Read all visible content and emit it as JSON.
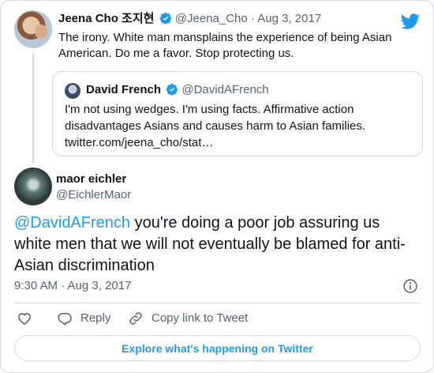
{
  "parent_tweet": {
    "name": "Jeena Cho 조지현",
    "handle": "@Jeena_Cho",
    "separator": "·",
    "date": "Aug 3, 2017",
    "text": "The irony. White man mansplains the experience of being Asian American. Do me a favor. Stop protecting us."
  },
  "quoted_tweet": {
    "name": "David French",
    "handle": "@DavidAFrench",
    "text": "I'm not using wedges. I'm using facts. Affirmative action disadvantages Asians and causes harm to Asian families. twitter.com/jeena_cho/stat…"
  },
  "main_tweet": {
    "name": "maor eichler",
    "handle": "@EichlerMaor",
    "mention": "@DavidAFrench",
    "text": " you're doing a poor job assuring us white men that we will not eventually be blamed for anti-Asian discrimination",
    "timestamp": "9:30 AM · Aug 3, 2017"
  },
  "actions": {
    "reply_label": "Reply",
    "copy_label": "Copy link to Tweet"
  },
  "explore_label": "Explore what's happening on Twitter",
  "colors": {
    "accent": "#1d9bf0",
    "muted": "#536471",
    "border": "#cfd9de"
  },
  "icons": [
    "twitter-logo-icon",
    "verified-badge-icon",
    "info-icon",
    "heart-icon",
    "reply-icon",
    "link-icon"
  ]
}
